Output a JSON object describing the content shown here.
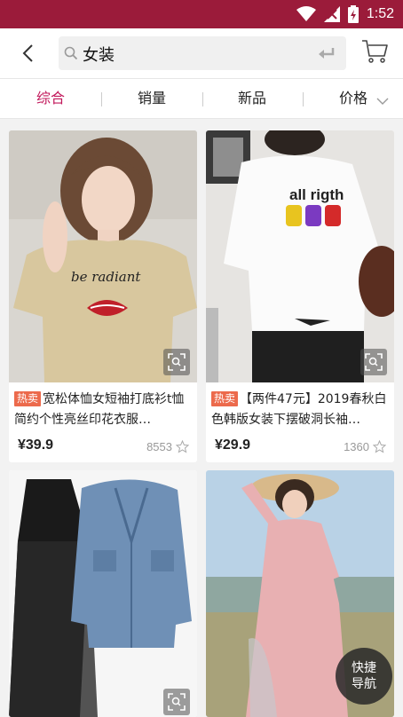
{
  "status_bar": {
    "time": "1:52",
    "icons": [
      "wifi-icon",
      "signal-icon",
      "battery-icon"
    ]
  },
  "header": {
    "back_icon": "back-arrow-icon",
    "search_value": "女装",
    "search_icon": "search-icon",
    "enter_icon": "enter-icon",
    "cart_icon": "cart-icon"
  },
  "tabs": [
    {
      "label": "综合",
      "active": true
    },
    {
      "label": "销量",
      "active": false
    },
    {
      "label": "新品",
      "active": false
    },
    {
      "label": "价格",
      "active": false
    }
  ],
  "products": [
    {
      "badge": "热卖",
      "title": "宽松体恤女短袖打底衫t恤简约个性亮丝印花衣服…",
      "price": "¥39.9",
      "sales": "8553",
      "shirt_text": "be radiant"
    },
    {
      "badge": "热卖",
      "title": "【两件47元】2019春秋白色韩版女装下摆破洞长袖…",
      "price": "¥29.9",
      "sales": "1360",
      "shirt_text": "all rigth"
    },
    {
      "badge": "",
      "title": "",
      "price": "",
      "sales": ""
    },
    {
      "badge": "",
      "title": "",
      "price": "",
      "sales": ""
    }
  ],
  "fab": {
    "line1": "快捷",
    "line2": "导航"
  },
  "colors": {
    "brand": "#9b1b3a",
    "active_tab": "#c2185b",
    "hot_badge": "#ec6a4c"
  }
}
